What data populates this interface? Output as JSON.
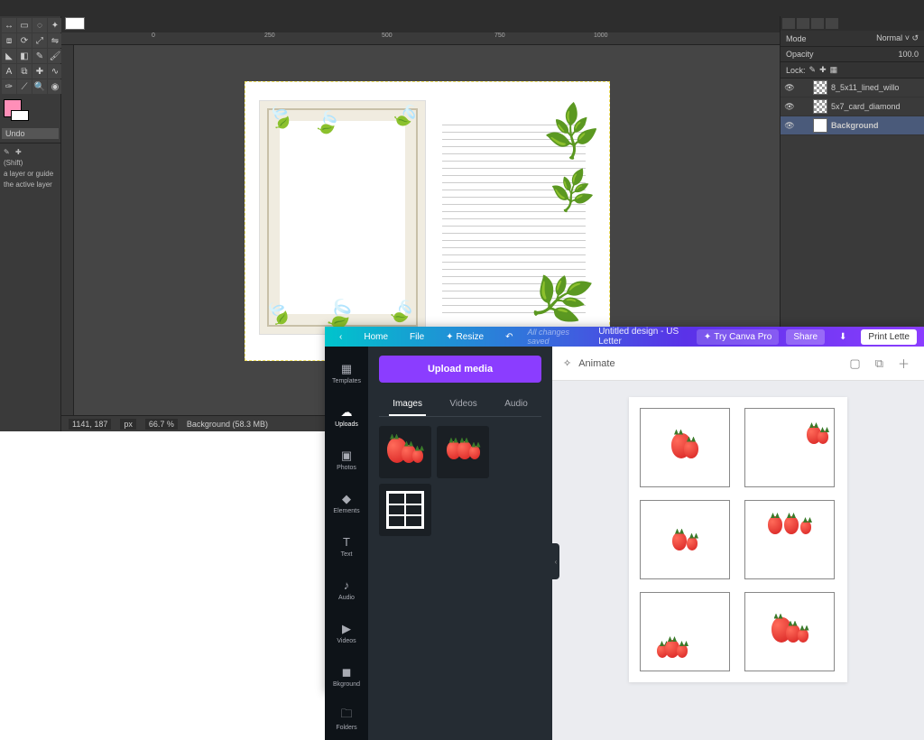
{
  "gimp": {
    "undo_label": "Undo",
    "opts_line1": "(Shift)",
    "opts_line2": "a layer or guide",
    "opts_line3": "the active layer",
    "mode_label": "Mode",
    "mode_value": "Normal",
    "opacity_label": "Opacity",
    "opacity_value": "100.0",
    "lock_label": "Lock:",
    "layers": [
      {
        "name": "8_5x11_lined_willo",
        "checker": true
      },
      {
        "name": "5x7_card_diamond",
        "checker": true
      },
      {
        "name": "Background",
        "checker": false
      }
    ],
    "ruler_ticks": [
      "0",
      "250",
      "500",
      "750",
      "1000"
    ],
    "status": {
      "coords": "1141, 187",
      "unit": "px",
      "zoom": "66.7 %",
      "layer": "Background (58.3 MB)"
    }
  },
  "canva": {
    "top": {
      "back": "‹",
      "home": "Home",
      "file": "File",
      "resize": "Resize",
      "saved": "All changes saved",
      "title": "Untitled design - US Letter",
      "pro": "Try Canva Pro",
      "share": "Share",
      "download_icon": "⬇",
      "print": "Print Lette"
    },
    "rail": [
      {
        "icon": "▦",
        "label": "Templates"
      },
      {
        "icon": "☁",
        "label": "Uploads"
      },
      {
        "icon": "▣",
        "label": "Photos"
      },
      {
        "icon": "◆",
        "label": "Elements"
      },
      {
        "icon": "T",
        "label": "Text"
      },
      {
        "icon": "♪",
        "label": "Audio"
      },
      {
        "icon": "▶",
        "label": "Videos"
      },
      {
        "icon": "◼",
        "label": "Bkground"
      },
      {
        "icon": "🗀",
        "label": "Folders"
      }
    ],
    "rail_active": 1,
    "panel": {
      "upload_label": "Upload media",
      "tabs": [
        "Images",
        "Videos",
        "Audio"
      ],
      "tab_active": 0
    },
    "workspace": {
      "animate_label": "Animate",
      "animate_icon": "✧"
    }
  }
}
